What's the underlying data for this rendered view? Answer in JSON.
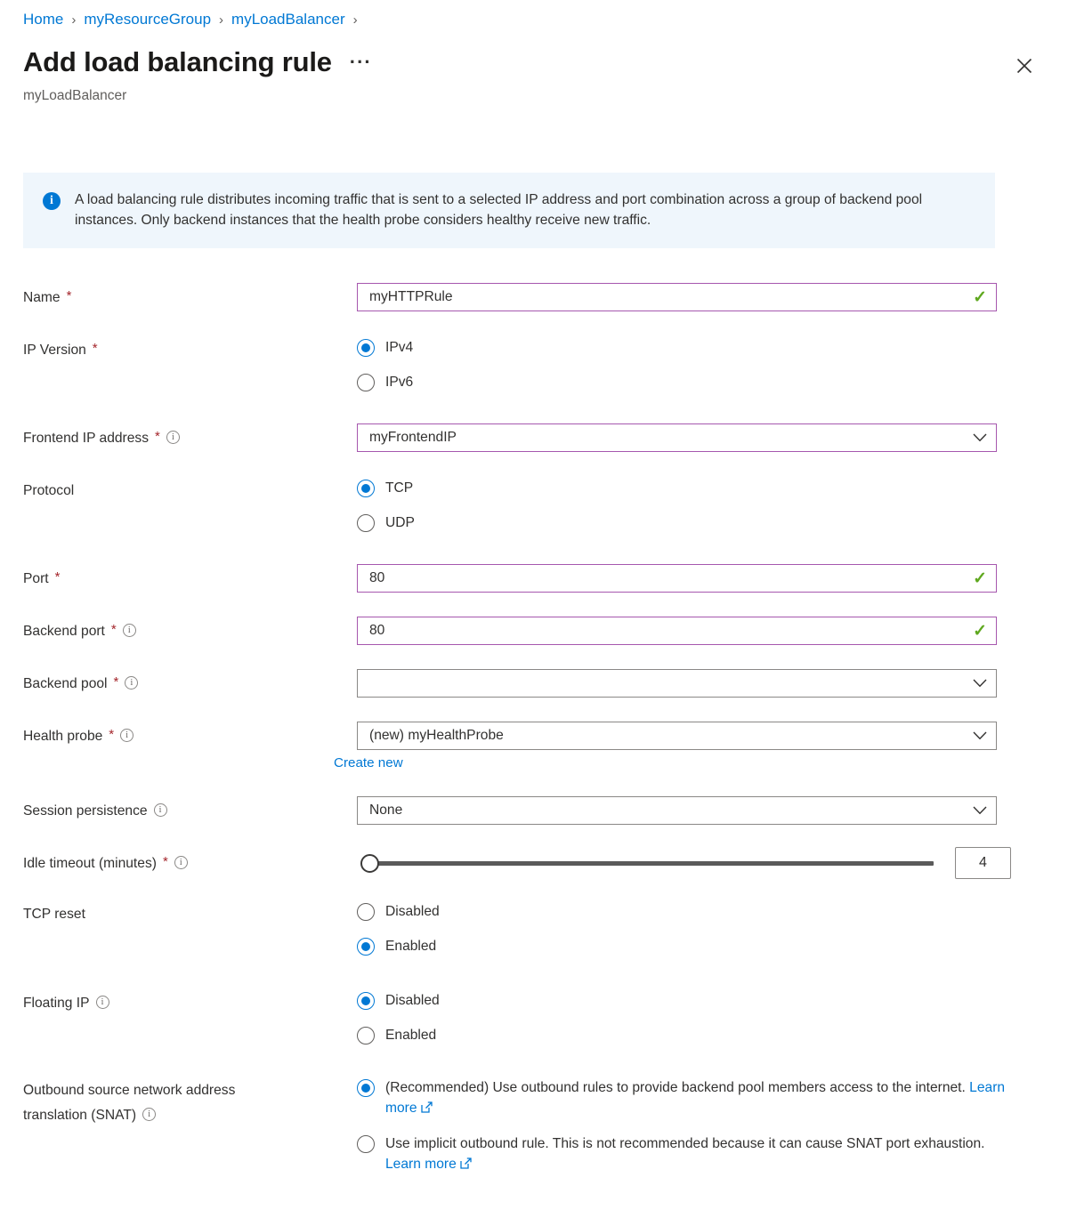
{
  "breadcrumb": {
    "items": [
      "Home",
      "myResourceGroup",
      "myLoadBalancer"
    ],
    "separator": "›"
  },
  "header": {
    "title": "Add load balancing rule",
    "subtitle": "myLoadBalancer",
    "more_menu": "···",
    "close_icon": "close-icon"
  },
  "info_banner": {
    "icon": "info-icon",
    "text": "A load balancing rule distributes incoming traffic that is sent to a selected IP address and port combination across a group of backend pool instances. Only backend instances that the health probe considers healthy receive new traffic.",
    "background": "#eff6fc",
    "icon_color": "#0078d4"
  },
  "colors": {
    "link": "#0078d4",
    "required_asterisk": "#a4262c",
    "validated_border": "#a657ae",
    "default_border": "#8a8886",
    "check_green": "#5fa81f",
    "radio_selected": "#0078d4"
  },
  "fields": {
    "name": {
      "label": "Name",
      "required": true,
      "value": "myHTTPRule",
      "placeholder": "",
      "validated": true,
      "status_icon": "checkmark-icon"
    },
    "ip_version": {
      "label": "IP Version",
      "required": true,
      "options": [
        "IPv4",
        "IPv6"
      ],
      "selected": "IPv4"
    },
    "frontend_ip": {
      "label": "Frontend IP address",
      "required": true,
      "has_info": true,
      "value": "myFrontendIP",
      "validated": true
    },
    "protocol": {
      "label": "Protocol",
      "required": false,
      "options": [
        "TCP",
        "UDP"
      ],
      "selected": "TCP"
    },
    "port": {
      "label": "Port",
      "required": true,
      "value": "80",
      "validated": true,
      "status_icon": "checkmark-icon"
    },
    "backend_port": {
      "label": "Backend port",
      "required": true,
      "has_info": true,
      "value": "80",
      "validated": true,
      "status_icon": "checkmark-icon"
    },
    "backend_pool": {
      "label": "Backend pool",
      "required": true,
      "has_info": true,
      "value": "",
      "validated": false
    },
    "health_probe": {
      "label": "Health probe",
      "required": true,
      "has_info": true,
      "value": "(new) myHealthProbe",
      "validated": false,
      "create_new_link": "Create new"
    },
    "session_persistence": {
      "label": "Session persistence",
      "required": false,
      "has_info": true,
      "value": "None",
      "validated": false
    },
    "idle_timeout": {
      "label": "Idle timeout (minutes)",
      "required": true,
      "has_info": true,
      "value": "4",
      "min": 4,
      "max": 30
    },
    "tcp_reset": {
      "label": "TCP reset",
      "required": false,
      "options": [
        "Disabled",
        "Enabled"
      ],
      "selected": "Enabled"
    },
    "floating_ip": {
      "label": "Floating IP",
      "required": false,
      "has_info": true,
      "options": [
        "Disabled",
        "Enabled"
      ],
      "selected": "Disabled"
    },
    "snat": {
      "label_line1": "Outbound source network address",
      "label_line2": "translation (SNAT)",
      "required": false,
      "has_info": true,
      "selected": 0,
      "options": [
        {
          "text": "(Recommended) Use outbound rules to provide backend pool members access to the internet.",
          "link": "Learn more"
        },
        {
          "text": "Use implicit outbound rule. This is not recommended because it can cause SNAT port exhaustion.",
          "link": "Learn more"
        }
      ]
    }
  }
}
